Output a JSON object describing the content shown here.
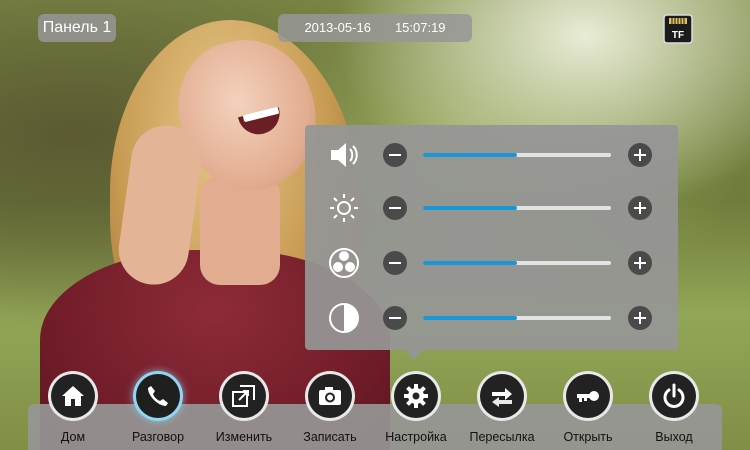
{
  "top_bar": {
    "panel": "Панель 1",
    "date": "2013-05-16",
    "time": "15:07:19",
    "card_badge": "TF"
  },
  "settings_popup": {
    "sliders": [
      {
        "icon": "speaker-icon",
        "level": 0.5
      },
      {
        "icon": "brightness-icon",
        "level": 0.5
      },
      {
        "icon": "color-icon",
        "level": 0.5
      },
      {
        "icon": "contrast-icon",
        "level": 0.5
      }
    ]
  },
  "nav": {
    "items": [
      {
        "label": "Дом",
        "icon": "home-icon"
      },
      {
        "label": "Разговор",
        "icon": "phone-icon",
        "active": true
      },
      {
        "label": "Изменить",
        "icon": "switch-window-icon"
      },
      {
        "label": "Записать",
        "icon": "camera-icon"
      },
      {
        "label": "Настройка",
        "icon": "gear-icon"
      },
      {
        "label": "Пересылка",
        "icon": "transfer-icon"
      },
      {
        "label": "Открыть",
        "icon": "key-icon"
      },
      {
        "label": "Выход",
        "icon": "power-icon"
      }
    ]
  },
  "colors": {
    "slider_fill": "#1a97d6",
    "active_glow": "#8fd7f0"
  }
}
